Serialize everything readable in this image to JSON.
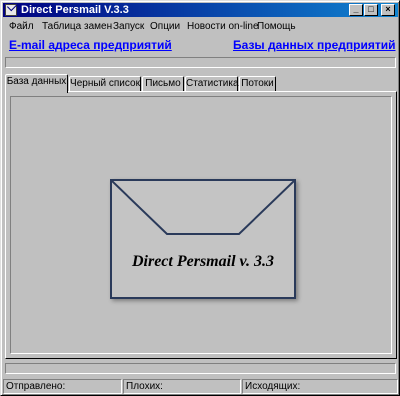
{
  "window": {
    "title": "Direct Persmail V.3.3",
    "controls": {
      "minimize": "_",
      "maximize": "□",
      "close": "×"
    }
  },
  "menu": [
    "Файл",
    "Таблица замен",
    "Запуск",
    "Опции",
    "Новости on-line",
    "Помощь"
  ],
  "links": {
    "left": "E-mail адреса предприятий",
    "right": "Базы данных предприятий"
  },
  "tabs": [
    {
      "label": "База данных",
      "active": true
    },
    {
      "label": "Черный список",
      "active": false
    },
    {
      "label": "Письмо",
      "active": false
    },
    {
      "label": "Статистика",
      "active": false
    },
    {
      "label": "Потоки",
      "active": false
    }
  ],
  "envelope": {
    "text": "Direct Persmail v. 3.3",
    "icon": "envelope-icon"
  },
  "status": {
    "sent": "Отправлено:",
    "bad": "Плохих:",
    "outgoing": "Исходящих:"
  },
  "colors": {
    "title_start": "#000080",
    "title_end": "#1084d0",
    "link": "#0000ff",
    "face": "#c0c0c0",
    "envelope_stroke": "#2a3a5a"
  }
}
